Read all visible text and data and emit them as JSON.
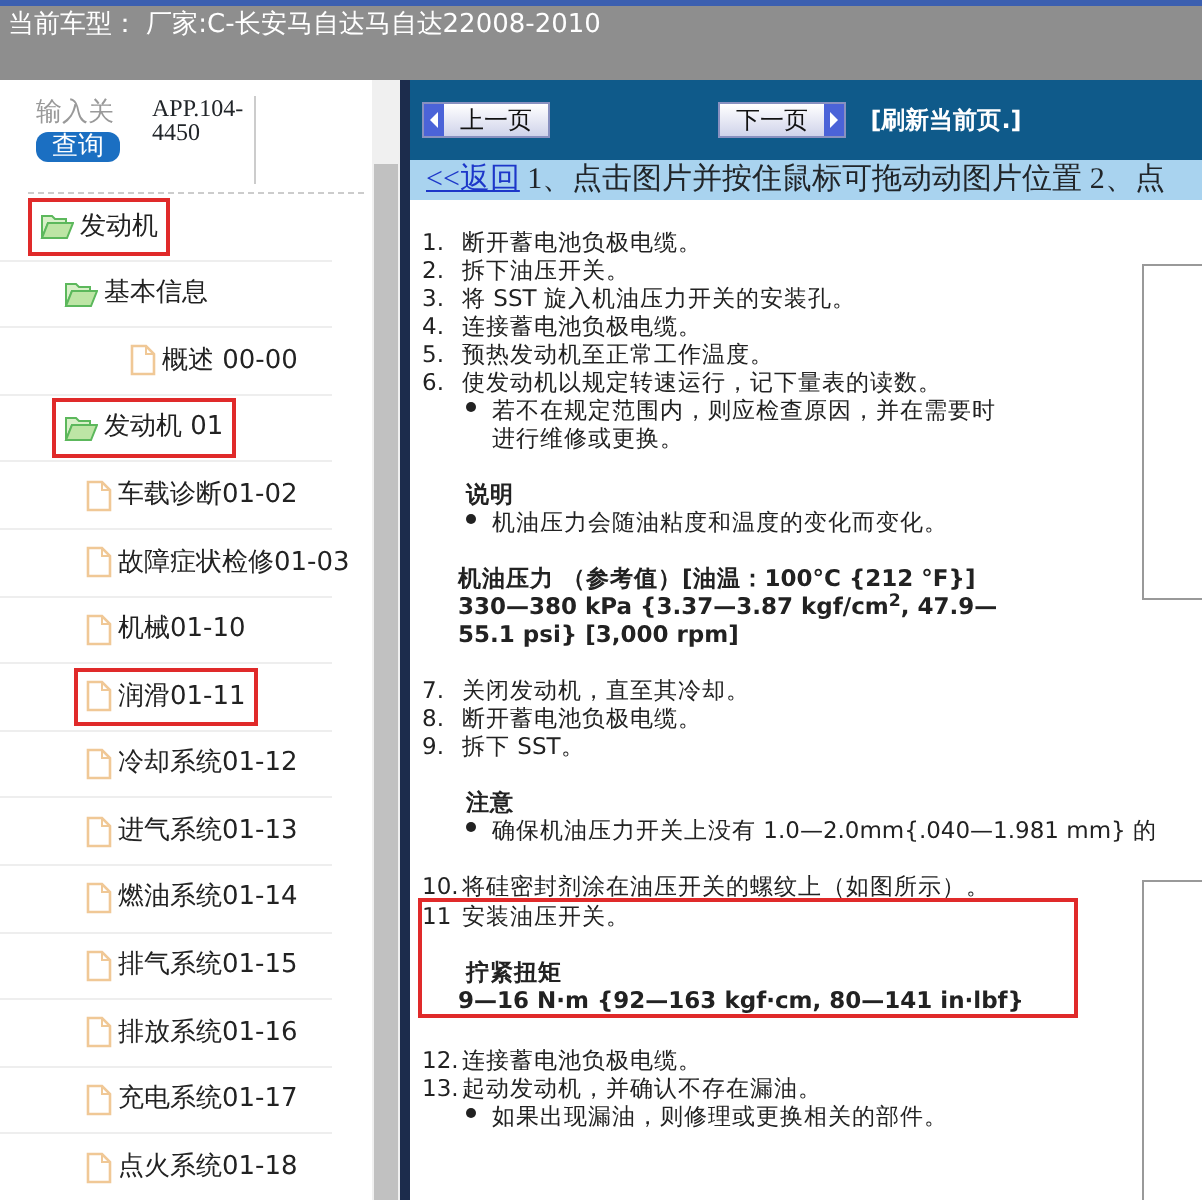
{
  "header": {
    "title": "当前车型： 厂家:C-长安马自达马自达22008-2010"
  },
  "search": {
    "placeholder": "输入关",
    "button": "查询",
    "code": "APP.104-4450"
  },
  "tree": [
    {
      "label": "发动机",
      "kind": "folder",
      "highlighted": true,
      "children": [
        {
          "label": "基本信息",
          "kind": "folder",
          "highlighted": false,
          "children": [
            {
              "label": "概述 00-00",
              "kind": "file",
              "highlighted": false
            }
          ]
        },
        {
          "label": "发动机 01",
          "kind": "folder",
          "highlighted": true,
          "children": [
            {
              "label": "车载诊断01-02",
              "kind": "file",
              "highlighted": false
            },
            {
              "label": "故障症状检修01-03",
              "kind": "file",
              "highlighted": false
            },
            {
              "label": "机械01-10",
              "kind": "file",
              "highlighted": false
            },
            {
              "label": "润滑01-11",
              "kind": "file",
              "highlighted": true
            },
            {
              "label": "冷却系统01-12",
              "kind": "file",
              "highlighted": false
            },
            {
              "label": "进气系统01-13",
              "kind": "file",
              "highlighted": false
            },
            {
              "label": "燃油系统01-14",
              "kind": "file",
              "highlighted": false
            },
            {
              "label": "排气系统01-15",
              "kind": "file",
              "highlighted": false
            },
            {
              "label": "排放系统01-16",
              "kind": "file",
              "highlighted": false
            },
            {
              "label": "充电系统01-17",
              "kind": "file",
              "highlighted": false
            },
            {
              "label": "点火系统01-18",
              "kind": "file",
              "highlighted": false
            }
          ]
        }
      ]
    }
  ],
  "nav": {
    "prev": "上一页",
    "next": "下一页",
    "refresh": "[刷新当前页.]"
  },
  "info": {
    "back": "<<返回",
    "text": "1、点击图片并按住鼠标可拖动动图片位置 2、点"
  },
  "document": [
    {
      "kind": "step",
      "number": "1.",
      "text": "断开蓄电池负极电缆。"
    },
    {
      "kind": "step",
      "number": "2.",
      "text": "拆下油压开关。"
    },
    {
      "kind": "step",
      "number": "3.",
      "text": "将 SST 旋入机油压力开关的安装孔。"
    },
    {
      "kind": "step",
      "number": "4.",
      "text": "连接蓄电池负极电缆。"
    },
    {
      "kind": "step",
      "number": "5.",
      "text": "预热发动机至正常工作温度。"
    },
    {
      "kind": "step",
      "number": "6.",
      "text": "使发动机以规定转速运行，记下量表的读数。"
    },
    {
      "kind": "bullet",
      "text": "若不在规定范围内，则应检查原因，并在需要时"
    },
    {
      "kind": "continuation",
      "text": "进行维修或更换。"
    },
    {
      "kind": "gap"
    },
    {
      "kind": "heading",
      "text": "说明"
    },
    {
      "kind": "bullet",
      "text": "机油压力会随油粘度和温度的变化而变化。"
    },
    {
      "kind": "gap"
    },
    {
      "kind": "value",
      "text": "机油压力 （参考值）[油温：100°C {212 °F}]"
    },
    {
      "kind": "value",
      "text": "330—380 kPa {3.37—3.87 kgf/cm$^{2}$, 47.9—"
    },
    {
      "kind": "value",
      "text": "55.1 psi} [3,000 rpm]"
    },
    {
      "kind": "gap"
    },
    {
      "kind": "step",
      "number": "7.",
      "text": "关闭发动机，直至其冷却。"
    },
    {
      "kind": "step",
      "number": "8.",
      "text": "断开蓄电池负极电缆。"
    },
    {
      "kind": "step",
      "number": "9.",
      "text": "拆下 SST。"
    },
    {
      "kind": "gap"
    },
    {
      "kind": "heading",
      "text": "注意"
    },
    {
      "kind": "bullet",
      "text": "确保机油压力开关上没有 1.0—2.0mm{.040—1.981 mm} 的"
    },
    {
      "kind": "gap"
    },
    {
      "kind": "step",
      "number": "10.",
      "text": "将硅密封剂涂在油压开关的螺纹上（如图所示）。"
    },
    {
      "kind": "step",
      "number": "11",
      "text": "安装油压开关。",
      "highlighted": true
    },
    {
      "kind": "gap",
      "highlighted": true
    },
    {
      "kind": "heading",
      "text": "拧紧扭矩",
      "highlighted": true
    },
    {
      "kind": "value",
      "text": "9—16 N·m {92—163 kgf·cm, 80—141 in·lbf}",
      "highlighted": true
    },
    {
      "kind": "gap"
    },
    {
      "kind": "step",
      "number": "12.",
      "text": "连接蓄电池负极电缆。"
    },
    {
      "kind": "step",
      "number": "13.",
      "text": "起动发动机，并确认不存在漏油。"
    },
    {
      "kind": "bullet",
      "text": "如果出现漏油，则修理或更换相关的部件。"
    }
  ]
}
